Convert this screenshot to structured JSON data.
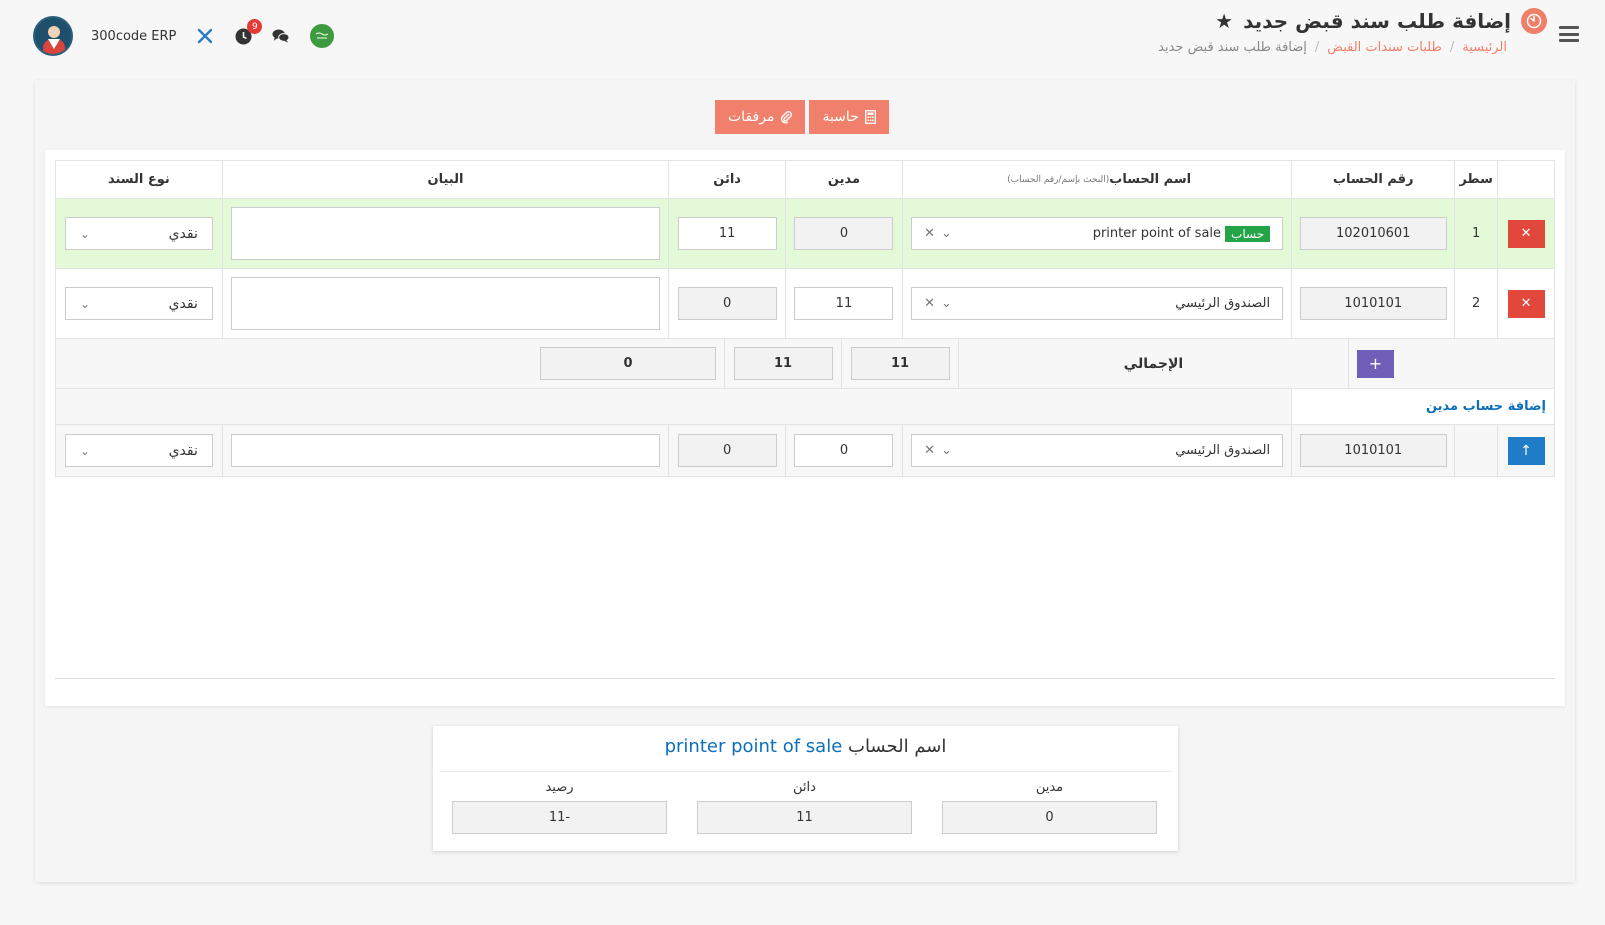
{
  "header": {
    "title": "إضافة طلب سند قبض جديد",
    "breadcrumb": {
      "home": "الرئيسية",
      "list": "طلبات سندات القبض",
      "current": "إضافة طلب سند قبض جديد"
    },
    "company": "300code ERP",
    "notification_count": "9"
  },
  "actions": {
    "calculator_label": "حاسبة",
    "attachments_label": "مرفقات"
  },
  "grid": {
    "columns": {
      "line": "سطر",
      "account_number": "رقم الحساب",
      "account_name": "اسم الحساب",
      "account_name_hint": "(البحث بإسم/رقم الحساب)",
      "debit": "مدين",
      "credit": "دائن",
      "statement": "البيان",
      "voucher_type": "نوع السند"
    },
    "rows": [
      {
        "line": "1",
        "account_number": "102010601",
        "account_tag": "حساب",
        "account_name": "printer point of sale",
        "debit": "0",
        "credit": "11",
        "statement": "",
        "voucher_type": "نقدي"
      },
      {
        "line": "2",
        "account_number": "1010101",
        "account_name": "الصندوق الرئيسي",
        "debit": "11",
        "credit": "0",
        "statement": "",
        "voucher_type": "نقدي"
      }
    ],
    "totals": {
      "label": "الإجمالي",
      "debit": "11",
      "credit": "11",
      "difference": "0"
    },
    "add_debit_link": "إضافة حساب مدين",
    "new_row": {
      "account_number": "1010101",
      "account_name": "الصندوق الرئيسي",
      "debit": "0",
      "credit": "0",
      "statement": "",
      "voucher_type": "نقدي"
    }
  },
  "account_info": {
    "title_prefix": "اسم الحساب",
    "account_name": "printer point of sale",
    "debit_label": "مدين",
    "debit_value": "0",
    "credit_label": "دائن",
    "credit_value": "11",
    "balance_label": "رصيد",
    "balance_value": "11-"
  },
  "colors": {
    "accent": "#f0806b",
    "row_highlight": "#e3f9d7",
    "danger": "#e1473b",
    "primary": "#1e7dc6",
    "purple": "#6f5fb8",
    "success": "#25a347",
    "link": "#0d6fb8"
  },
  "icons": {
    "menu": "hamburger-icon",
    "title": "gauge-icon",
    "favorite": "star-icon",
    "tools": "tools-icon",
    "clock": "clock-icon",
    "chat": "chat-icon",
    "language": "saudi-flag-icon",
    "calculator": "calculator-icon",
    "attachment": "paperclip-icon",
    "remove": "close-icon",
    "add": "plus-icon",
    "move_up": "arrow-up-icon",
    "dropdown": "chevron-down-icon"
  }
}
